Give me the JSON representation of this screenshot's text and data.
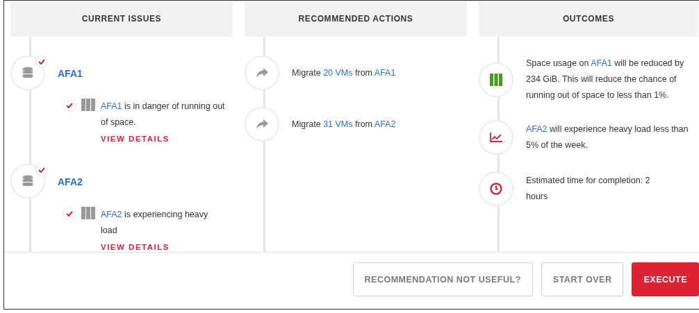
{
  "columns": [
    {
      "title": "CURRENT ISSUES",
      "kind": "issues",
      "items": [
        {
          "title": "AFA1",
          "checked": true,
          "details": [
            {
              "checked": true,
              "parts": [
                {
                  "text": "AFA1",
                  "link": true
                },
                {
                  "text": " is in danger of running out of space.",
                  "link": false
                }
              ],
              "action": "VIEW DETAILS"
            }
          ]
        },
        {
          "title": "AFA2",
          "checked": true,
          "details": [
            {
              "checked": true,
              "parts": [
                {
                  "text": "AFA2",
                  "link": true
                },
                {
                  "text": " is experiencing heavy load",
                  "link": false
                }
              ],
              "action": "VIEW DETAILS"
            }
          ]
        }
      ]
    },
    {
      "title": "RECOMMENDED ACTIONS",
      "kind": "steps",
      "items": [
        {
          "kind": "migrate",
          "parts": [
            {
              "text": "Migrate ",
              "link": false
            },
            {
              "text": "20 VMs",
              "link": true
            },
            {
              "text": " from ",
              "link": false
            },
            {
              "text": "AFA1",
              "link": true
            }
          ]
        },
        {
          "kind": "migrate",
          "parts": [
            {
              "text": "Migrate ",
              "link": false
            },
            {
              "text": "31 VMs",
              "link": true
            },
            {
              "text": " from ",
              "link": false
            },
            {
              "text": "AFA2",
              "link": true
            }
          ]
        }
      ]
    },
    {
      "title": "OUTCOMES",
      "kind": "steps",
      "items": [
        {
          "kind": "storage",
          "parts": [
            {
              "text": "Space usage on ",
              "link": false
            },
            {
              "text": "AFA1",
              "link": true
            },
            {
              "text": " will be reduced by 234 GiB. This will reduce the chance of running out of space to less than 1%.",
              "link": false
            }
          ]
        },
        {
          "kind": "load",
          "parts": [
            {
              "text": "AFA2",
              "link": true
            },
            {
              "text": " will experience heavy load less than 5% of the week.",
              "link": false
            }
          ]
        },
        {
          "kind": "time",
          "parts": [
            {
              "text": "Estimated time for completion: 2 hours",
              "link": false
            }
          ]
        }
      ]
    }
  ],
  "buttons": [
    {
      "label": "RECOMMENDATION NOT USEFUL?",
      "kind": "secondary"
    },
    {
      "label": "START OVER",
      "kind": "secondary"
    },
    {
      "label": "EXECUTE",
      "kind": "primary"
    }
  ]
}
